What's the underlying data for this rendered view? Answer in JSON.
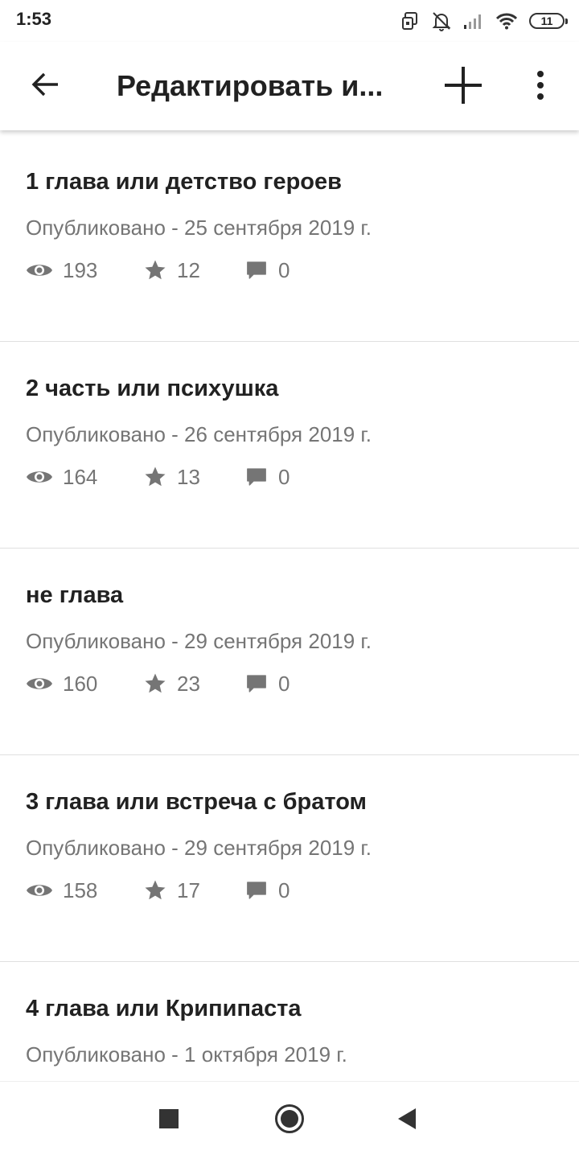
{
  "status_bar": {
    "time": "1:53",
    "battery": "11",
    "icons": [
      "screen-rotate-icon",
      "alarm-off-icon",
      "signal-icon",
      "wifi-icon",
      "battery-icon"
    ]
  },
  "app_bar": {
    "title": "Редактировать и...",
    "icons": [
      "back-arrow-icon",
      "plus-icon",
      "more-vert-icon"
    ]
  },
  "chapters": [
    {
      "title": "1 глава или детство героев",
      "date": "Опубликовано - 25 сентября 2019 г.",
      "views": "193",
      "stars": "12",
      "comments": "0"
    },
    {
      "title": "2 часть или психушка",
      "date": "Опубликовано - 26 сентября 2019 г.",
      "views": "164",
      "stars": "13",
      "comments": "0"
    },
    {
      "title": "не глава",
      "date": "Опубликовано - 29 сентября 2019 г.",
      "views": "160",
      "stars": "23",
      "comments": "0"
    },
    {
      "title": "3 глава или встреча с братом",
      "date": "Опубликовано - 29 сентября 2019 г.",
      "views": "158",
      "stars": "17",
      "comments": "0"
    },
    {
      "title": "4 глава или Крипипаста",
      "date": "Опубликовано - 1 октября 2019 г.",
      "views": "",
      "stars": "",
      "comments": ""
    }
  ],
  "nav_bar": {
    "icons": [
      "recents-square-icon",
      "home-circle-icon",
      "back-triangle-icon"
    ]
  },
  "colors": {
    "text_primary": "#212121",
    "text_secondary": "#757575",
    "icon_gray": "#757575",
    "divider": "#e0e0e0"
  }
}
